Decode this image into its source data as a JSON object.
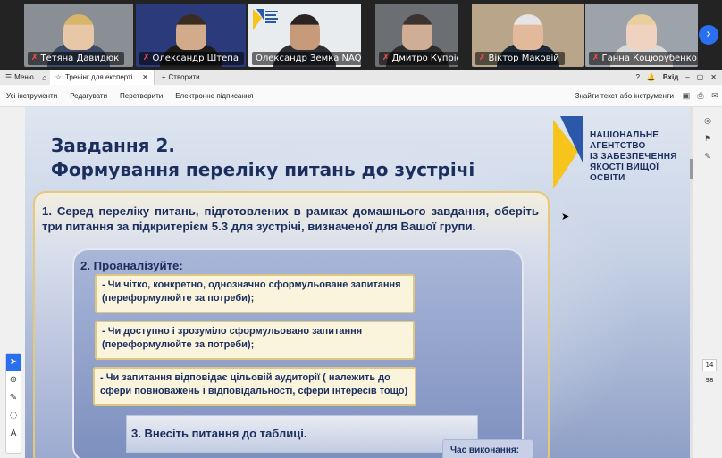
{
  "participants": [
    {
      "name": "Тетяна Давидюк",
      "bg": "#8a8f96",
      "skin": "#e7c7a6",
      "hair": "#d9b56a",
      "shirt": "#3c4a66"
    },
    {
      "name": "Олександр Штепа",
      "bg": "#2b3a7a",
      "skin": "#d2ab8a",
      "hair": "#3a2c22",
      "shirt": "#1c1c1c"
    },
    {
      "name": "Олександр Земка NAQA",
      "bg": "#e9ecef",
      "skin": "#c79a7a",
      "hair": "#2a2522",
      "shirt": "#2c2f36"
    },
    {
      "name": "Дмитро Купрієнко",
      "bg": "#6b6e72",
      "skin": "#cfae95",
      "hair": "#3b3330",
      "shirt": "#2d2d2d"
    },
    {
      "name": "Віктор Маковій",
      "bg": "#b9a58a",
      "skin": "#e3b99c",
      "hair": "#e4e4e4",
      "shirt": "#1e2a3a"
    },
    {
      "name": "Ганна Коцюрубенко",
      "bg": "#9da3ab",
      "skin": "#f0d2c0",
      "hair": "#e8cf9c",
      "shirt": "#d9d9d9"
    }
  ],
  "active_participant_index": 2,
  "chrome": {
    "menu_label": "Меню",
    "tab_title": "Тренінг для експерті...",
    "create_label": "Створити",
    "login_label": "Вхід"
  },
  "toolbar": {
    "items": [
      "Усі інструменти",
      "Редагувати",
      "Перетворити",
      "Електронне підписання"
    ],
    "search_placeholder": "Знайти текст або інструменти"
  },
  "page": {
    "current": "14",
    "total": "98"
  },
  "slide": {
    "title_line1": "Завдання 2.",
    "title_line2": "Формування переліку питань до зустрічі",
    "logo_lines": [
      "НАЦІОНАЛЬНЕ",
      "АГЕНТСТВО",
      "ІЗ ЗАБЕЗПЕЧЕННЯ",
      "ЯКОСТІ ВИЩОЇ ОСВІТИ"
    ],
    "step1": "1. Серед переліку питань, підготовлених в рамках домашнього завдання, оберіть три питання за підкритерієм 5.3 для зустрічі, визначеної для Вашої групи.",
    "step2": "2. Проаналізуйте:",
    "questions": [
      "- Чи чітко, конкретно, однозначно сформульоване запитання (переформулюйте за потреби);",
      "- Чи доступно і зрозуміло сформульовано запитання (переформулюйте за потреби);",
      "- Чи запитання відповідає цільовій аудиторії ( належить до сфери повноважень і відповідальності, сфери інтересів тощо)"
    ],
    "step3": "3. Внесіть питання до таблиці.",
    "time_label": "Час виконання:"
  },
  "colors": {
    "accent": "#2a6ff0",
    "title": "#1b2e5e",
    "box_border": "#e6c977",
    "logo_yellow": "#f6c41a",
    "logo_blue": "#2b58a8"
  }
}
